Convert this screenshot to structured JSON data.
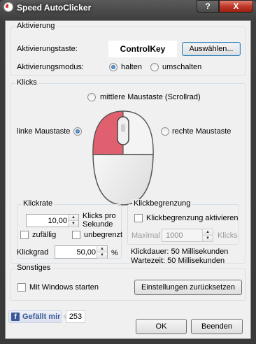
{
  "window": {
    "title": "Speed AutoClicker",
    "help_label": "?",
    "close_label": "X"
  },
  "activation": {
    "group_label": "Aktivierung",
    "hotkey_label": "Aktivierungstaste:",
    "hotkey_value": "ControlKey",
    "select_button": "Auswählen...",
    "mode_label": "Aktivierungsmodus:",
    "mode_options": [
      {
        "label": "halten",
        "selected": true
      },
      {
        "label": "umschalten",
        "selected": false
      }
    ]
  },
  "clicks": {
    "group_label": "Klicks",
    "middle_button": "mittlere Maustaste (Scrollrad)",
    "left_button": "linke Maustaste",
    "right_button": "rechte Maustaste",
    "selected_button": "left",
    "rate": {
      "group_label": "Klickrate",
      "value": "10,00",
      "unit": "Klicks pro Sekunde",
      "random_label": "zufällig",
      "unlimited_label": "unbegrenzt"
    },
    "degree": {
      "label": "Klickgrad",
      "value": "50,00",
      "unit": "%"
    },
    "limit": {
      "group_label": "Klickbegrenzung",
      "enable_label": "Klickbegrenzung aktivieren",
      "max_label": "Maximal",
      "max_value": "1000",
      "unit": "Klicks"
    },
    "duration_text": "Klickdauer: 50 Millisekunden",
    "wait_text": "Wartezeit: 50 Millisekunden"
  },
  "other": {
    "group_label": "Sonstiges",
    "startup_label": "Mit Windows starten",
    "reset_button": "Einstellungen zurücksetzen"
  },
  "footer": {
    "like_label": "Gefällt mir",
    "like_count": "253",
    "ok": "OK",
    "exit": "Beenden"
  },
  "colors": {
    "mouse_highlight": "#e06070",
    "accent": "#3c7fb1",
    "facebook": "#3b5998"
  }
}
